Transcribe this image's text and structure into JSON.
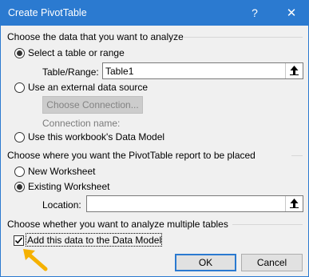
{
  "window": {
    "title": "Create PivotTable",
    "help_glyph": "?",
    "close_glyph": "✕"
  },
  "section_data": {
    "title": "Choose the data that you want to analyze",
    "select_range_label": "Select a table or range",
    "table_range_label": "Table/Range:",
    "table_range_value": "Table1",
    "external_source_label": "Use an external data source",
    "choose_connection_label": "Choose Connection...",
    "connection_name_label": "Connection name:",
    "data_model_label": "Use this workbook's Data Model",
    "selected": "select_range"
  },
  "section_placement": {
    "title": "Choose where you want the PivotTable report to be placed",
    "new_worksheet_label": "New Worksheet",
    "existing_worksheet_label": "Existing Worksheet",
    "location_label": "Location:",
    "location_value": "",
    "selected": "existing_worksheet"
  },
  "section_multiple": {
    "title": "Choose whether you want to analyze multiple tables",
    "add_to_model_label": "Add this data to the Data Model",
    "add_to_model_checked": true
  },
  "buttons": {
    "ok_label": "OK",
    "cancel_label": "Cancel"
  },
  "colors": {
    "titlebar": "#2b7ad0",
    "annotation_arrow": "#f5b100"
  }
}
